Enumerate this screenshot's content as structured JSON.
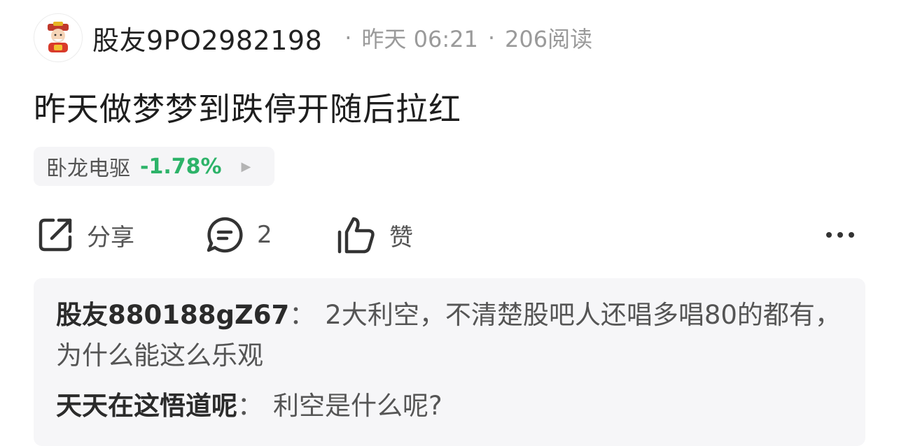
{
  "post": {
    "author": "股友9PO2982198",
    "time": "昨天 06:21",
    "reads": "206阅读",
    "separator": "·",
    "title": "昨天做梦梦到跌停开随后拉红"
  },
  "stock": {
    "name": "卧龙电驱",
    "change": "-1.78%",
    "change_color": "#2db369"
  },
  "actions": {
    "share_label": "分享",
    "comment_count": "2",
    "like_label": "赞"
  },
  "comments": [
    {
      "user": "股友880188gZ67",
      "colon": "：",
      "text": "2大利空，不清楚股吧人还唱多唱80的都有，为什么能这么乐观"
    },
    {
      "user": "天天在这悟道呢",
      "colon": "：",
      "text": "利空是什么呢?"
    }
  ],
  "icons": {
    "avatar": "caishen-avatar-icon",
    "share": "share-icon",
    "comment": "comment-icon",
    "like": "thumbs-up-icon",
    "more": "more-dots-icon",
    "arrow": "triangle-right-icon"
  }
}
